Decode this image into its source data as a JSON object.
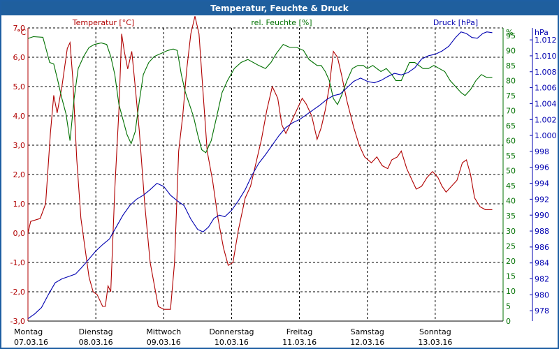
{
  "window": {
    "title": "Temperatur, Feuchte & Druck"
  },
  "colors": {
    "temp": "#b00000",
    "hum": "#007000",
    "press": "#0000b0",
    "grid": "#000000",
    "frame": "#1f5f9e"
  },
  "chart_data": {
    "type": "line",
    "title": "Temperatur, Feuchte & Druck",
    "grid": true,
    "x_days": [
      {
        "weekday": "Montag",
        "date": "07.03.16"
      },
      {
        "weekday": "Dienstag",
        "date": "08.03.16"
      },
      {
        "weekday": "Mittwoch",
        "date": "09.03.16"
      },
      {
        "weekday": "Donnerstag",
        "date": "10.03.16"
      },
      {
        "weekday": "Freitag",
        "date": "11.03.16"
      },
      {
        "weekday": "Samstag",
        "date": "12.03.16"
      },
      {
        "weekday": "Sonntag",
        "date": "13.03.16"
      }
    ],
    "x_range_days": [
      0,
      7.0
    ],
    "axes": {
      "temp": {
        "unit": "°C",
        "label": "Temperatur [°C]",
        "range": [
          -3.0,
          7.0
        ],
        "ticks": [
          "7,0",
          "6,0",
          "5,0",
          "4,0",
          "3,0",
          "2,0",
          "1,0",
          "0,0",
          "-1,0",
          "-2,0",
          "-3,0"
        ]
      },
      "hum": {
        "unit": "%",
        "label": "rel. Feuchte [%]",
        "range": [
          0,
          97.5
        ],
        "ticks": [
          "95",
          "90",
          "85",
          "80",
          "75",
          "70",
          "65",
          "60",
          "55",
          "50",
          "45",
          "40",
          "35",
          "30",
          "25",
          "20",
          "15",
          "10",
          "5",
          "0"
        ]
      },
      "press": {
        "unit": "hPa",
        "label": "Druck [hPa]",
        "range": [
          976.7,
          1013.5
        ],
        "ticks": [
          "1.012",
          "1.010",
          "1.008",
          "1.006",
          "1.004",
          "1.002",
          "1.000",
          "998",
          "996",
          "994",
          "992",
          "990",
          "988",
          "986",
          "984",
          "982",
          "980",
          "978"
        ]
      }
    },
    "series": [
      {
        "name": "Temperatur [°C]",
        "axis": "temp",
        "points": [
          [
            0,
            0
          ],
          [
            0.04,
            0.4
          ],
          [
            0.18,
            0.5
          ],
          [
            0.26,
            1.0
          ],
          [
            0.33,
            3.4
          ],
          [
            0.38,
            4.7
          ],
          [
            0.43,
            4.1
          ],
          [
            0.5,
            5.0
          ],
          [
            0.58,
            6.3
          ],
          [
            0.62,
            6.5
          ],
          [
            0.66,
            5.3
          ],
          [
            0.72,
            2.5
          ],
          [
            0.78,
            0.5
          ],
          [
            0.84,
            -0.5
          ],
          [
            0.9,
            -1.5
          ],
          [
            0.96,
            -2.0
          ],
          [
            1.02,
            -2.1
          ],
          [
            1.1,
            -2.5
          ],
          [
            1.14,
            -2.5
          ],
          [
            1.18,
            -1.8
          ],
          [
            1.22,
            -2.0
          ],
          [
            1.28,
            1.5
          ],
          [
            1.34,
            4.2
          ],
          [
            1.38,
            6.8
          ],
          [
            1.42,
            6.2
          ],
          [
            1.47,
            5.6
          ],
          [
            1.53,
            6.2
          ],
          [
            1.58,
            5.0
          ],
          [
            1.64,
            3.5
          ],
          [
            1.72,
            1.0
          ],
          [
            1.8,
            -1.0
          ],
          [
            1.88,
            -2.0
          ],
          [
            1.92,
            -2.5
          ],
          [
            2.0,
            -2.6
          ],
          [
            2.1,
            -2.6
          ],
          [
            2.16,
            -1.0
          ],
          [
            2.22,
            2.8
          ],
          [
            2.28,
            4.0
          ],
          [
            2.34,
            5.6
          ],
          [
            2.4,
            6.8
          ],
          [
            2.46,
            7.4
          ],
          [
            2.52,
            6.8
          ],
          [
            2.58,
            4.8
          ],
          [
            2.64,
            2.8
          ],
          [
            2.72,
            1.8
          ],
          [
            2.8,
            0.5
          ],
          [
            2.88,
            -0.5
          ],
          [
            2.95,
            -1.1
          ],
          [
            3.02,
            -1.0
          ],
          [
            3.1,
            0.1
          ],
          [
            3.2,
            1.2
          ],
          [
            3.28,
            1.6
          ],
          [
            3.36,
            2.4
          ],
          [
            3.44,
            3.2
          ],
          [
            3.52,
            4.2
          ],
          [
            3.6,
            5.0
          ],
          [
            3.68,
            4.6
          ],
          [
            3.74,
            3.7
          ],
          [
            3.8,
            3.4
          ],
          [
            3.88,
            3.8
          ],
          [
            3.96,
            4.2
          ],
          [
            4.04,
            4.6
          ],
          [
            4.1,
            4.4
          ],
          [
            4.18,
            4.0
          ],
          [
            4.26,
            3.2
          ],
          [
            4.32,
            3.6
          ],
          [
            4.38,
            4.2
          ],
          [
            4.44,
            5.0
          ],
          [
            4.5,
            6.2
          ],
          [
            4.56,
            6.0
          ],
          [
            4.62,
            5.4
          ],
          [
            4.7,
            4.5
          ],
          [
            4.8,
            3.6
          ],
          [
            4.88,
            3.0
          ],
          [
            4.96,
            2.6
          ],
          [
            5.06,
            2.4
          ],
          [
            5.14,
            2.6
          ],
          [
            5.22,
            2.3
          ],
          [
            5.3,
            2.2
          ],
          [
            5.36,
            2.5
          ],
          [
            5.44,
            2.6
          ],
          [
            5.5,
            2.8
          ],
          [
            5.58,
            2.2
          ],
          [
            5.66,
            1.8
          ],
          [
            5.72,
            1.5
          ],
          [
            5.8,
            1.6
          ],
          [
            5.88,
            1.9
          ],
          [
            5.96,
            2.1
          ],
          [
            6.04,
            1.9
          ],
          [
            6.1,
            1.6
          ],
          [
            6.16,
            1.4
          ],
          [
            6.24,
            1.6
          ],
          [
            6.32,
            1.8
          ],
          [
            6.4,
            2.4
          ],
          [
            6.46,
            2.5
          ],
          [
            6.52,
            2.0
          ],
          [
            6.58,
            1.2
          ],
          [
            6.66,
            0.9
          ],
          [
            6.74,
            0.8
          ],
          [
            6.84,
            0.8
          ]
        ]
      },
      {
        "name": "rel. Feuchte [%]",
        "axis": "hum",
        "points": [
          [
            0,
            94
          ],
          [
            0.08,
            94.6
          ],
          [
            0.22,
            94.4
          ],
          [
            0.32,
            86
          ],
          [
            0.38,
            85.5
          ],
          [
            0.44,
            80
          ],
          [
            0.5,
            74
          ],
          [
            0.56,
            69
          ],
          [
            0.62,
            60
          ],
          [
            0.68,
            74
          ],
          [
            0.74,
            84
          ],
          [
            0.82,
            88
          ],
          [
            0.9,
            91
          ],
          [
            0.98,
            92
          ],
          [
            1.08,
            92.5
          ],
          [
            1.16,
            92
          ],
          [
            1.22,
            88
          ],
          [
            1.28,
            82
          ],
          [
            1.34,
            72
          ],
          [
            1.4,
            67
          ],
          [
            1.46,
            62
          ],
          [
            1.52,
            59
          ],
          [
            1.58,
            63
          ],
          [
            1.64,
            73
          ],
          [
            1.7,
            82
          ],
          [
            1.78,
            86
          ],
          [
            1.86,
            88
          ],
          [
            1.96,
            89
          ],
          [
            2.06,
            90
          ],
          [
            2.14,
            90.5
          ],
          [
            2.2,
            90
          ],
          [
            2.26,
            82
          ],
          [
            2.32,
            76
          ],
          [
            2.38,
            72
          ],
          [
            2.44,
            68
          ],
          [
            2.5,
            62
          ],
          [
            2.56,
            57
          ],
          [
            2.62,
            56
          ],
          [
            2.7,
            60
          ],
          [
            2.78,
            68
          ],
          [
            2.86,
            76
          ],
          [
            2.94,
            80
          ],
          [
            3.04,
            84
          ],
          [
            3.14,
            86
          ],
          [
            3.24,
            87
          ],
          [
            3.32,
            86
          ],
          [
            3.4,
            85
          ],
          [
            3.5,
            84
          ],
          [
            3.58,
            86
          ],
          [
            3.66,
            89
          ],
          [
            3.76,
            92
          ],
          [
            3.86,
            91
          ],
          [
            3.96,
            91
          ],
          [
            4.06,
            90
          ],
          [
            4.14,
            87
          ],
          [
            4.2,
            86
          ],
          [
            4.26,
            85
          ],
          [
            4.32,
            85
          ],
          [
            4.38,
            83
          ],
          [
            4.44,
            80
          ],
          [
            4.5,
            74
          ],
          [
            4.56,
            72
          ],
          [
            4.62,
            75
          ],
          [
            4.7,
            80
          ],
          [
            4.78,
            84
          ],
          [
            4.86,
            85
          ],
          [
            4.94,
            85
          ],
          [
            5.0,
            84
          ],
          [
            5.08,
            85
          ],
          [
            5.14,
            84
          ],
          [
            5.2,
            83
          ],
          [
            5.28,
            84
          ],
          [
            5.36,
            82
          ],
          [
            5.42,
            80
          ],
          [
            5.5,
            80
          ],
          [
            5.56,
            83
          ],
          [
            5.62,
            86
          ],
          [
            5.7,
            86
          ],
          [
            5.76,
            85
          ],
          [
            5.82,
            84
          ],
          [
            5.9,
            84
          ],
          [
            5.98,
            85
          ],
          [
            6.06,
            84
          ],
          [
            6.14,
            83
          ],
          [
            6.22,
            80
          ],
          [
            6.3,
            78
          ],
          [
            6.38,
            76
          ],
          [
            6.44,
            75
          ],
          [
            6.52,
            77
          ],
          [
            6.6,
            80
          ],
          [
            6.68,
            82
          ],
          [
            6.76,
            81
          ],
          [
            6.84,
            81
          ]
        ]
      },
      {
        "name": "Druck [hPa]",
        "axis": "press",
        "points": [
          [
            0,
            977
          ],
          [
            0.1,
            977.6
          ],
          [
            0.2,
            978.4
          ],
          [
            0.3,
            980
          ],
          [
            0.4,
            981.5
          ],
          [
            0.5,
            982
          ],
          [
            0.6,
            982.3
          ],
          [
            0.7,
            982.6
          ],
          [
            0.8,
            983.5
          ],
          [
            0.9,
            984.5
          ],
          [
            1.0,
            985.5
          ],
          [
            1.1,
            986.3
          ],
          [
            1.2,
            987
          ],
          [
            1.3,
            988.5
          ],
          [
            1.4,
            990
          ],
          [
            1.5,
            991.2
          ],
          [
            1.6,
            992
          ],
          [
            1.7,
            992.5
          ],
          [
            1.8,
            993.2
          ],
          [
            1.9,
            994
          ],
          [
            2.0,
            993.6
          ],
          [
            2.1,
            992.5
          ],
          [
            2.2,
            991.8
          ],
          [
            2.3,
            991.2
          ],
          [
            2.4,
            989.5
          ],
          [
            2.5,
            988.2
          ],
          [
            2.58,
            987.9
          ],
          [
            2.66,
            988.5
          ],
          [
            2.74,
            989.6
          ],
          [
            2.82,
            990
          ],
          [
            2.9,
            989.8
          ],
          [
            3.0,
            990.6
          ],
          [
            3.1,
            991.8
          ],
          [
            3.2,
            993.2
          ],
          [
            3.3,
            995
          ],
          [
            3.4,
            996.5
          ],
          [
            3.5,
            997.6
          ],
          [
            3.6,
            998.8
          ],
          [
            3.7,
            1000
          ],
          [
            3.8,
            1001
          ],
          [
            3.9,
            1001.6
          ],
          [
            4.0,
            1002
          ],
          [
            4.1,
            1002.6
          ],
          [
            4.2,
            1003.2
          ],
          [
            4.3,
            1003.8
          ],
          [
            4.4,
            1004.5
          ],
          [
            4.5,
            1005
          ],
          [
            4.6,
            1005.2
          ],
          [
            4.7,
            1006
          ],
          [
            4.8,
            1006.8
          ],
          [
            4.9,
            1007.2
          ],
          [
            5.0,
            1006.8
          ],
          [
            5.1,
            1006.6
          ],
          [
            5.2,
            1006.9
          ],
          [
            5.3,
            1007.4
          ],
          [
            5.4,
            1007.8
          ],
          [
            5.5,
            1007.6
          ],
          [
            5.6,
            1007.9
          ],
          [
            5.7,
            1008.5
          ],
          [
            5.8,
            1009.6
          ],
          [
            5.9,
            1010
          ],
          [
            6.0,
            1010.2
          ],
          [
            6.1,
            1010.6
          ],
          [
            6.2,
            1011.2
          ],
          [
            6.3,
            1012.3
          ],
          [
            6.38,
            1013
          ],
          [
            6.46,
            1012.8
          ],
          [
            6.54,
            1012.3
          ],
          [
            6.62,
            1012.2
          ],
          [
            6.7,
            1012.8
          ],
          [
            6.76,
            1013
          ],
          [
            6.84,
            1012.9
          ]
        ]
      }
    ]
  }
}
